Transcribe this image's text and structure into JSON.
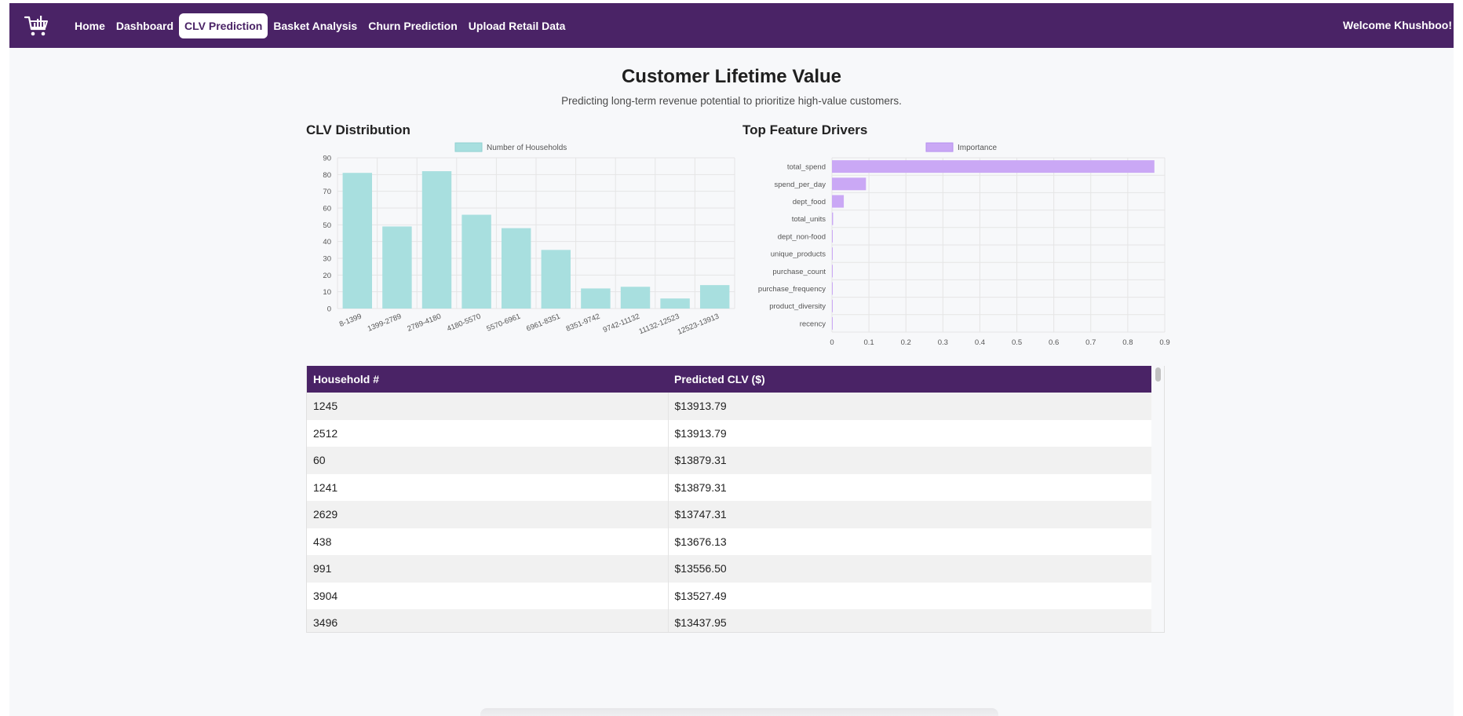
{
  "nav": {
    "logo_icon": "shopping-cart-icon",
    "items": [
      {
        "label": "Home",
        "active": false
      },
      {
        "label": "Dashboard",
        "active": false
      },
      {
        "label": "CLV Prediction",
        "active": true
      },
      {
        "label": "Basket Analysis",
        "active": false
      },
      {
        "label": "Churn Prediction",
        "active": false
      },
      {
        "label": "Upload Retail Data",
        "active": false
      }
    ],
    "welcome": "Welcome Khushboo!"
  },
  "header": {
    "title": "Customer Lifetime Value",
    "subtitle": "Predicting long-term revenue potential to prioritize high-value customers."
  },
  "colors": {
    "nav_bg": "#4a2366",
    "clv_bar": "#a8dfdf",
    "importance_bar": "#caa8f5"
  },
  "chart_data": [
    {
      "type": "bar",
      "title": "CLV Distribution",
      "categories": [
        "8-1399",
        "1399-2789",
        "2789-4180",
        "4180-5570",
        "5570-6961",
        "6961-8351",
        "8351-9742",
        "9742-11132",
        "11132-12523",
        "12523-13913"
      ],
      "series": [
        {
          "name": "Number of Households",
          "values": [
            81,
            49,
            82,
            56,
            48,
            35,
            12,
            13,
            6,
            14
          ]
        }
      ],
      "ylim": [
        0,
        90
      ],
      "yticks": [
        0,
        10,
        20,
        30,
        40,
        50,
        60,
        70,
        80,
        90
      ],
      "grid": true,
      "legend": "top-center"
    },
    {
      "type": "bar",
      "orientation": "horizontal",
      "title": "Top Feature Drivers",
      "categories": [
        "total_spend",
        "spend_per_day",
        "dept_food",
        "total_units",
        "dept_non-food",
        "unique_products",
        "purchase_count",
        "purchase_frequency",
        "product_diversity",
        "recency"
      ],
      "series": [
        {
          "name": "Importance",
          "values": [
            0.872,
            0.092,
            0.032,
            0.003,
            0.001,
            0.001,
            0.001,
            0.001,
            0.001,
            0.001
          ]
        }
      ],
      "xlim": [
        0,
        0.9
      ],
      "xticks": [
        "0",
        "0.1",
        "0.2",
        "0.3",
        "0.4",
        "0.5",
        "0.6",
        "0.7",
        "0.8",
        "0.9"
      ],
      "grid": true,
      "legend": "top-center"
    }
  ],
  "table": {
    "headers": [
      "Household #",
      "Predicted CLV ($)"
    ],
    "rows": [
      [
        "1245",
        "$13913.79"
      ],
      [
        "2512",
        "$13913.79"
      ],
      [
        "60",
        "$13879.31"
      ],
      [
        "1241",
        "$13879.31"
      ],
      [
        "2629",
        "$13747.31"
      ],
      [
        "438",
        "$13676.13"
      ],
      [
        "991",
        "$13556.50"
      ],
      [
        "3904",
        "$13527.49"
      ],
      [
        "3496",
        "$13437.95"
      ]
    ]
  }
}
